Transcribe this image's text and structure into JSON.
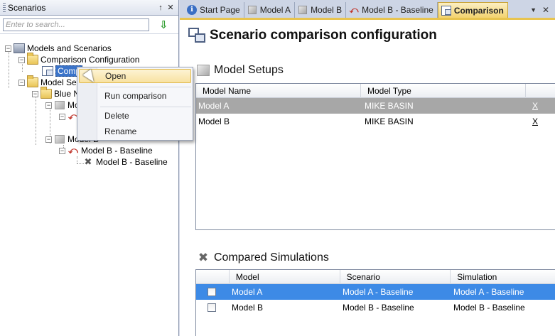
{
  "left_panel": {
    "title": "Scenarios",
    "pin_label": "↑",
    "close_label": "✕",
    "search_placeholder": "Enter to search..."
  },
  "tree": {
    "root": "Models and Scenarios",
    "comparison_config": "Comparison Configuration",
    "comparison_item": "Comp",
    "model_setups": "Model Set",
    "blue_nile": "Blue N",
    "model_a_partial": "Mo",
    "model_b_partial": "Model B",
    "model_b_baseline": "Model B - Baseline",
    "model_b_baseline_sim": "Model B - Baseline"
  },
  "context_menu": {
    "items": [
      "Open",
      "Run comparison",
      "Delete",
      "Rename"
    ]
  },
  "tabs": [
    {
      "label": "Start Page",
      "icon": "info-icon"
    },
    {
      "label": "Model A",
      "icon": "cube-icon"
    },
    {
      "label": "Model B",
      "icon": "cube-icon"
    },
    {
      "label": "Model B - Baseline",
      "icon": "scenario-fork-icon"
    },
    {
      "label": "Comparison",
      "icon": "comparison-icon",
      "active": true
    }
  ],
  "page": {
    "title": "Scenario comparison configuration"
  },
  "model_setups": {
    "title": "Model Setups",
    "columns": [
      "Model Name",
      "Model Type"
    ],
    "rows": [
      {
        "name": "Model A",
        "type": "MIKE BASIN",
        "action": "X"
      },
      {
        "name": "Model B",
        "type": "MIKE BASIN",
        "action": "X"
      }
    ]
  },
  "compared_simulations": {
    "title": "Compared Simulations",
    "columns": [
      "Model",
      "Scenario",
      "Simulation"
    ],
    "rows": [
      {
        "model": "Model A",
        "scenario": "Model A - Baseline",
        "simulation": "Model A - Baseline"
      },
      {
        "model": "Model B",
        "scenario": "Model B - Baseline",
        "simulation": "Model B - Baseline"
      }
    ]
  },
  "colors": {
    "accent_tab": "#f3d36f",
    "selection_blue": "#3d8ae6",
    "selection_gray": "#a7a7a7"
  }
}
